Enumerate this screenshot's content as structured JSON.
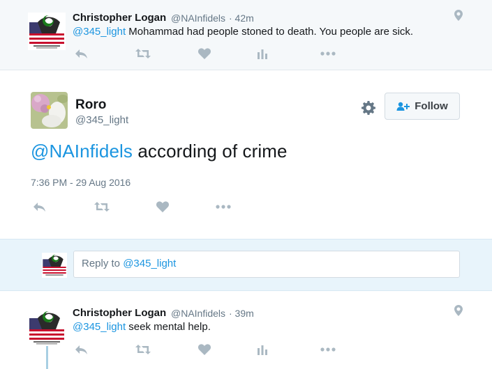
{
  "tweets": [
    {
      "name": "Christopher Logan",
      "handle": "@NAInfidels",
      "time": "· 42m",
      "mention": "@345_light",
      "text": " Mohammad had people stoned to death. You people are sick."
    },
    {
      "name": "Christopher Logan",
      "handle": "@NAInfidels",
      "time": "· 39m",
      "mention": "@345_light",
      "text": " seek mental help."
    }
  ],
  "main_tweet": {
    "name": "Roro",
    "handle": "@345_light",
    "mention": "@NAInfidels",
    "text": " according of crime",
    "timestamp": "7:36 PM - 29 Aug 2016",
    "follow_label": "Follow"
  },
  "reply": {
    "prefix": "Reply to ",
    "mention": "@345_light"
  },
  "icons": {
    "reply": "reply-icon",
    "retweet": "retweet-icon",
    "like": "heart-icon",
    "analytics": "analytics-icon",
    "more": "more-icon",
    "settings": "gear-icon",
    "location": "location-icon"
  },
  "colors": {
    "link": "#1b95e0",
    "icon": "#aab8c2",
    "context_bg": "#f5f8fa",
    "thread_line": "#a8cfe3"
  }
}
